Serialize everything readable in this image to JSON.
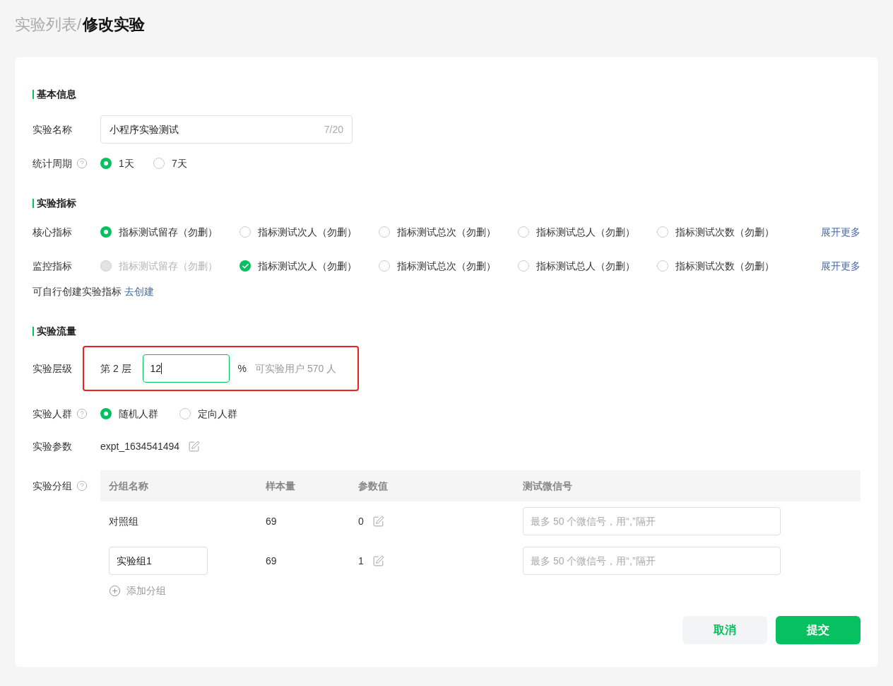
{
  "breadcrumb": {
    "parent": "实验列表/",
    "current": "修改实验"
  },
  "basic_info": {
    "title": "基本信息",
    "name_field": {
      "label": "实验名称",
      "value": "小程序实验测试",
      "counter": "7/20"
    },
    "period": {
      "label": "统计周期",
      "options": [
        {
          "label": "1天",
          "selected": true
        },
        {
          "label": "7天",
          "selected": false
        }
      ]
    }
  },
  "metrics": {
    "title": "实验指标",
    "core": {
      "label": "核心指标",
      "more": "展开更多",
      "options": [
        {
          "label": "指标测试留存（勿删）",
          "selected": true
        },
        {
          "label": "指标测试次人（勿删）",
          "selected": false
        },
        {
          "label": "指标测试总次（勿删）",
          "selected": false
        },
        {
          "label": "指标测试总人（勿删）",
          "selected": false
        },
        {
          "label": "指标测试次数（勿删）",
          "selected": false
        }
      ]
    },
    "monitor": {
      "label": "监控指标",
      "more": "展开更多",
      "options": [
        {
          "label": "指标测试留存（勿删）",
          "checked": false,
          "disabled": true
        },
        {
          "label": "指标测试次人（勿删）",
          "checked": true,
          "disabled": false
        },
        {
          "label": "指标测试总次（勿删）",
          "checked": false,
          "disabled": false
        },
        {
          "label": "指标测试总人（勿删）",
          "checked": false,
          "disabled": false
        },
        {
          "label": "指标测试次数（勿删）",
          "checked": false,
          "disabled": false
        }
      ]
    },
    "hint": {
      "text": "可自行创建实验指标",
      "link": "去创建"
    }
  },
  "traffic": {
    "title": "实验流量",
    "level": {
      "label": "实验层级",
      "layer": "第 2 层",
      "value": "12",
      "unit": "%",
      "available": "可实验用户 570 人"
    },
    "crowd": {
      "label": "实验人群",
      "options": [
        {
          "label": "随机人群",
          "selected": true
        },
        {
          "label": "定向人群",
          "selected": false
        }
      ]
    },
    "param": {
      "label": "实验参数",
      "value": "expt_1634541494"
    },
    "groups": {
      "label": "实验分组",
      "columns": [
        "分组名称",
        "样本量",
        "参数值",
        "测试微信号"
      ],
      "rows": [
        {
          "kind": "text",
          "name": "对照组",
          "sample": "69",
          "param": "0",
          "wechat_placeholder": "最多 50 个微信号，用“,”隔开"
        },
        {
          "kind": "input",
          "name": "实验组1",
          "sample": "69",
          "param": "1",
          "wechat_placeholder": "最多 50 个微信号，用“,”隔开"
        }
      ],
      "add": "添加分组"
    }
  },
  "buttons": [
    {
      "label": "取消",
      "kind": "secondary"
    },
    {
      "label": "提交",
      "kind": "primary"
    }
  ]
}
